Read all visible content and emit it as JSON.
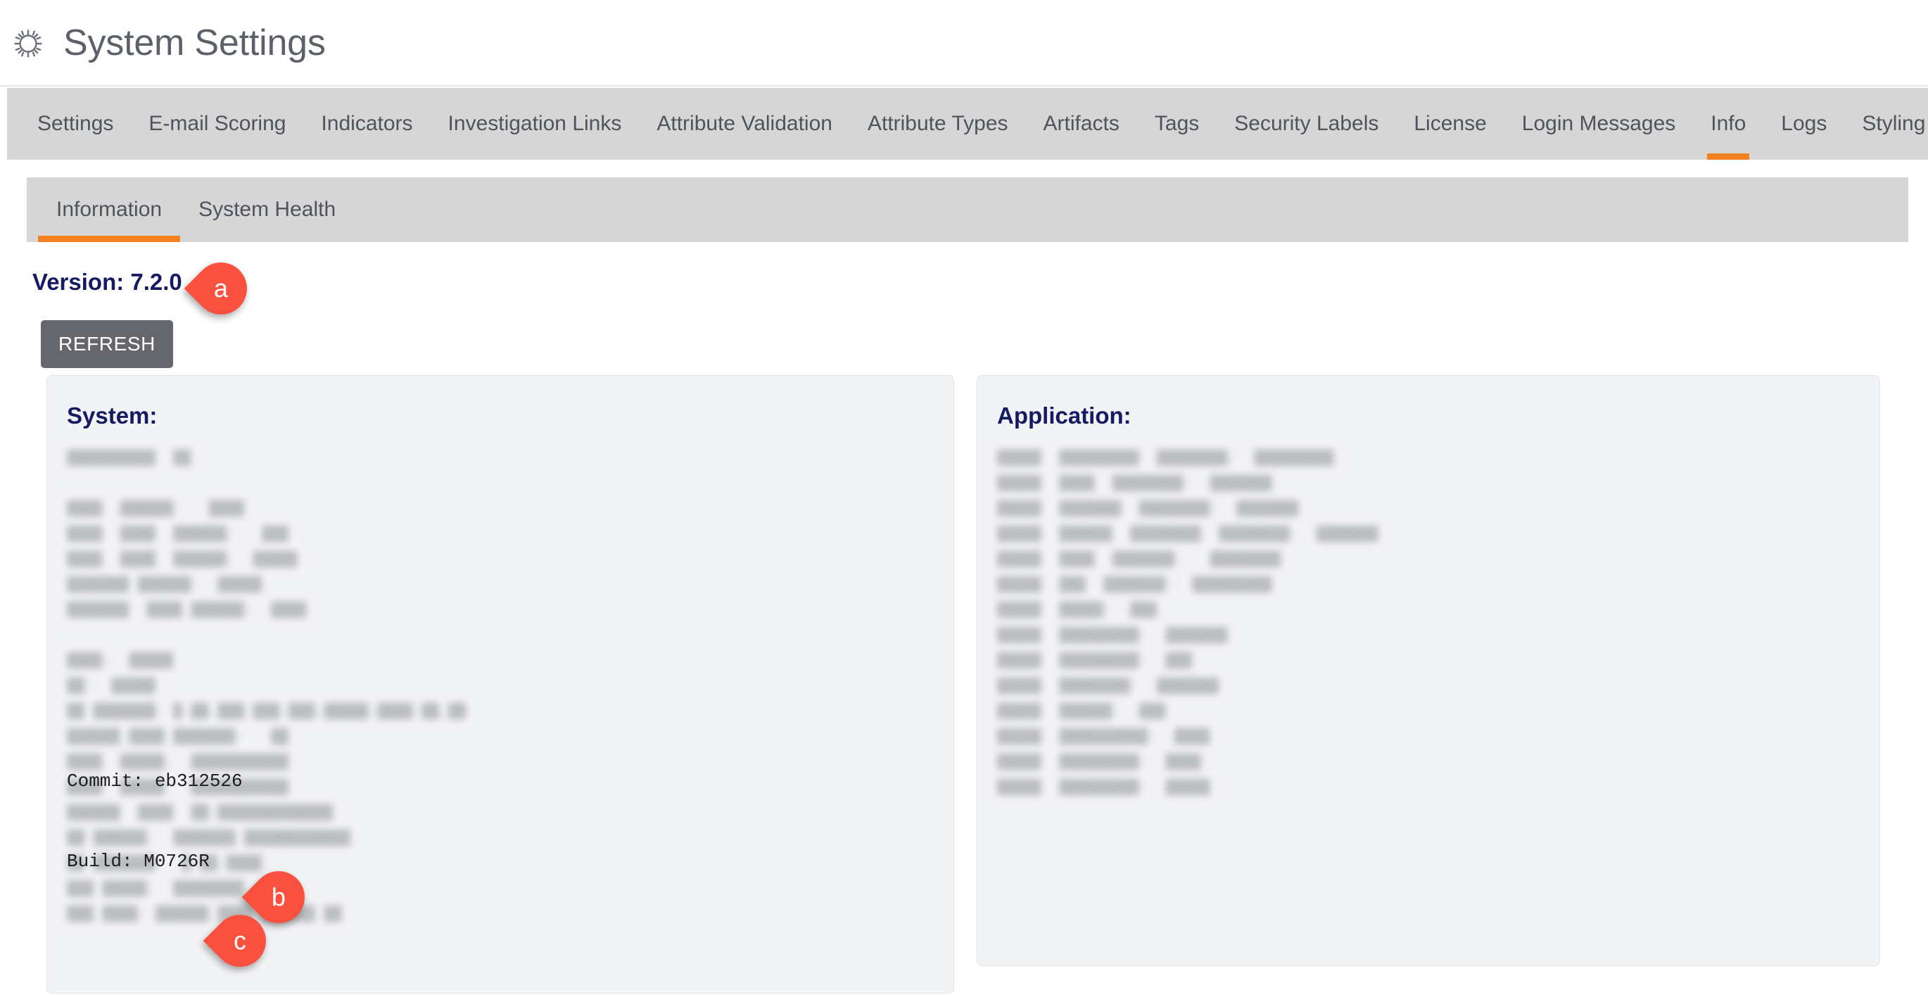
{
  "header": {
    "title": "System Settings",
    "icon": "gear-icon"
  },
  "nav": {
    "items": [
      {
        "label": "Settings",
        "active": false
      },
      {
        "label": "E-mail Scoring",
        "active": false
      },
      {
        "label": "Indicators",
        "active": false
      },
      {
        "label": "Investigation Links",
        "active": false
      },
      {
        "label": "Attribute Validation",
        "active": false
      },
      {
        "label": "Attribute Types",
        "active": false
      },
      {
        "label": "Artifacts",
        "active": false
      },
      {
        "label": "Tags",
        "active": false
      },
      {
        "label": "Security Labels",
        "active": false
      },
      {
        "label": "License",
        "active": false
      },
      {
        "label": "Login Messages",
        "active": false
      },
      {
        "label": "Info",
        "active": true
      },
      {
        "label": "Logs",
        "active": false
      },
      {
        "label": "Styling",
        "active": false
      }
    ]
  },
  "subnav": {
    "items": [
      {
        "label": "Information",
        "active": true
      },
      {
        "label": "System Health",
        "active": false
      }
    ]
  },
  "content": {
    "version_label": "Version: 7.2.0",
    "refresh_label": "REFRESH",
    "system_panel": {
      "heading": "System:",
      "redacted_body": "██████████  ██\n\n████  ██████:   ████\n████  ████  ██████:   ███\n████  ████  ██████:  █████\n███████ ██████:  █████\n███████  ████ ██████:  ████\n\n████:  █████\n██:  █████\n██ ███████: █.██.███-███.███.█████.████.██_██\n██████ ████ ███████:   ██\n████  █████:  ███████████\n████  █████:  ███████████\n██████  ████  ██:█████████████\n██ ██████:  ███████ ████████████\n██ ███████:  █.██.████\n███ █████:  ████████\n███ ████: ██████ ████ ██████ ██",
      "commit_line": "Commit: eb312526",
      "build_line": "Build: M0726R"
    },
    "application_panel": {
      "heading": "Application:",
      "redacted_body": "█████  █████████  ████████:  █████████\n█████  ████  ████████:  ███████\n█████  ███████  ████████:  ███████\n█████  ██████  ████████  ████████:  ███████\n█████  ████  ███████:   ████████\n█████  ███  ███████:  █████████\n█████  █████:  ███\n█████  █████████:  ███████\n█████  █████████:  ███\n█████  ████████:  ███████\n█████  ██████:  ███\n█████  ██████████:  ████\n█████  █████████:  ████\n█████  █████████:  █████"
    }
  },
  "annotations": [
    {
      "id": "a",
      "label": "a",
      "target": "version-line"
    },
    {
      "id": "b",
      "label": "b",
      "target": "commit-line"
    },
    {
      "id": "c",
      "label": "c",
      "target": "build-line"
    }
  ],
  "colors": {
    "accent_orange": "#f58220",
    "nav_background": "#d6d6d6",
    "heading_navy": "#151b63",
    "marker_red": "#f9503f",
    "button_grey": "#66666d",
    "panel_background": "#f2f3f5"
  }
}
